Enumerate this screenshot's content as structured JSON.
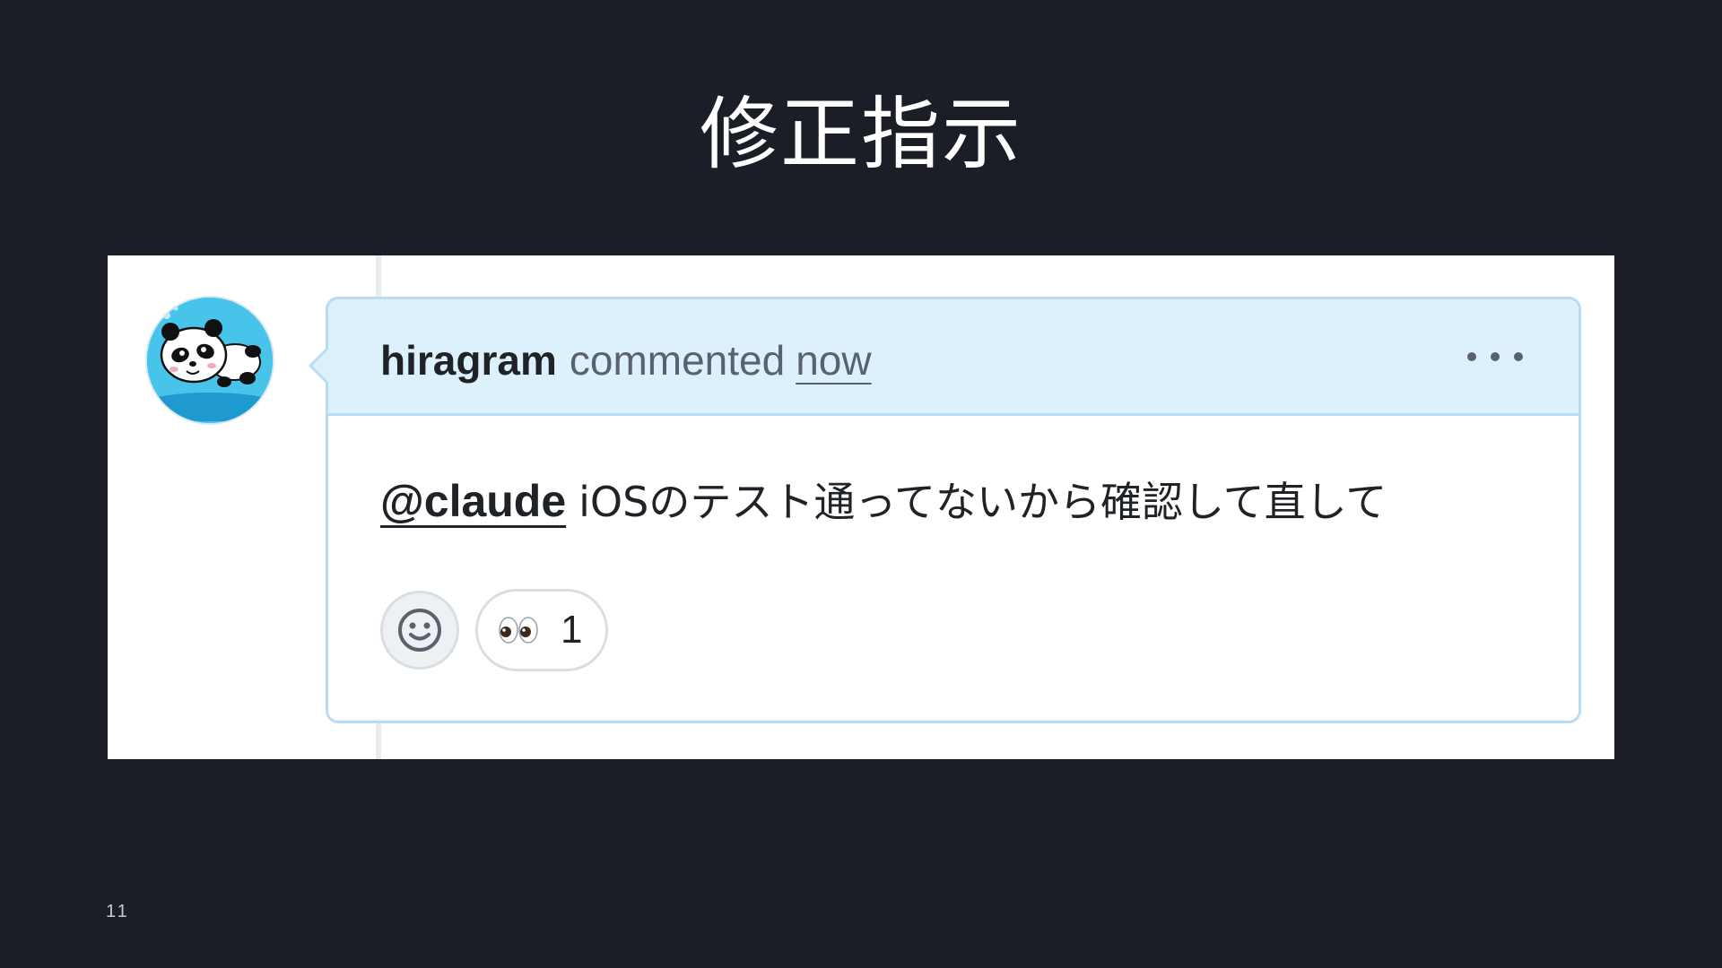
{
  "slide": {
    "title": "修正指示",
    "page_number": "11"
  },
  "comment": {
    "author": "hiragram",
    "action": "commented",
    "timestamp": "now",
    "mention": "@claude",
    "body": "iOSのテスト通ってないから確認して直して",
    "reactions": [
      {
        "icon": "eyes-emoji-icon",
        "count": "1"
      }
    ]
  },
  "colors": {
    "background": "#1b1d27",
    "header_bg": "#ddf1fc",
    "border": "#b7dcf4",
    "text": "#1f2328",
    "muted_text": "#59636e"
  }
}
